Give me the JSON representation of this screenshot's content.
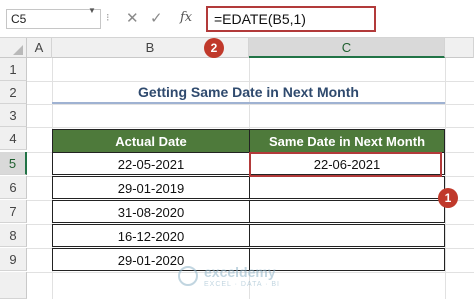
{
  "formula_bar": {
    "name_box": "C5",
    "separator": "⁝",
    "cancel": "✕",
    "enter": "✓",
    "fx": "fx",
    "formula": "=EDATE(B5,1)"
  },
  "columns": [
    "A",
    "B",
    "C"
  ],
  "rows": [
    "1",
    "2",
    "3",
    "4",
    "5",
    "6",
    "7",
    "8",
    "9"
  ],
  "title": "Getting Same Date in Next Month",
  "table": {
    "headers": [
      "Actual Date",
      "Same Date in Next Month"
    ],
    "rows": [
      [
        "22-05-2021",
        "22-06-2021"
      ],
      [
        "29-01-2019",
        ""
      ],
      [
        "31-08-2020",
        ""
      ],
      [
        "16-12-2020",
        ""
      ],
      [
        "29-01-2020",
        ""
      ]
    ]
  },
  "markers": [
    "1",
    "2"
  ],
  "watermark": {
    "name": "exceldemy",
    "tagline": "EXCEL · DATA · BI"
  },
  "colors": {
    "header_fill": "#4e7a3b",
    "highlight": "#b23a3a",
    "marker": "#c0392b",
    "title_text": "#2f4a6e",
    "selected_header": "#217346"
  }
}
